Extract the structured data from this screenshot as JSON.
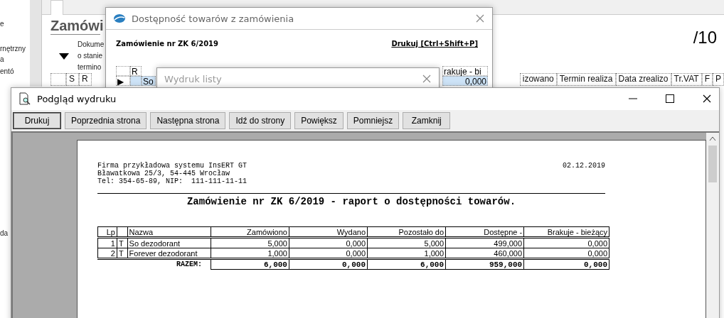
{
  "background_app": {
    "sidebar_items": [
      "e",
      "rnętrzny",
      "a",
      "entó",
      "da"
    ],
    "heading": "Zamówi",
    "info_lines": [
      "Dokume",
      "o stanie",
      "termino"
    ],
    "page_counter": "/10",
    "grid_columns_left": [
      "S",
      "R"
    ],
    "grid_columns_right": [
      "izowano",
      "Termin realiza",
      "Data zrealizo",
      "Tr.VAT",
      "F",
      "P"
    ]
  },
  "availability_dialog": {
    "title": "Dostępność towarów z zamówienia",
    "order_label": "Zamówienie nr ZK 6/2019",
    "print_link": "Drukuj [Ctrl+Shift+P]",
    "grid": {
      "row_pointer": "▶",
      "column_r": "R",
      "column_shortage": "rakuje - bi",
      "row_name": "So",
      "shortage_value": "0,000",
      "row_selected": true
    }
  },
  "print_list_window": {
    "title": "Wydruk listy"
  },
  "preview": {
    "title": "Podgląd wydruku",
    "toolbar": [
      {
        "label": "Drukuj",
        "selected": true
      },
      {
        "label": "Poprzednia strona",
        "selected": false
      },
      {
        "label": "Następna strona",
        "selected": false
      },
      {
        "label": "Idź do strony",
        "selected": false
      },
      {
        "label": "Powiększ",
        "selected": false
      },
      {
        "label": "Pomniejsz",
        "selected": false
      },
      {
        "label": "Zamknij",
        "selected": false
      }
    ],
    "report": {
      "company_lines": [
        "Firma przykładowa systemu InsERT GT",
        "Bławatkowa 25/3, 54-445 Wrocław",
        "Tel: 354-65-89, NIP:  111-111-11-11"
      ],
      "date": "02.12.2019",
      "title": "Zamówienie nr ZK 6/2019 - raport o dostępności towarów.",
      "columns": [
        "Lp",
        "",
        "Nazwa",
        "Zamówiono",
        "Wydano",
        "Pozostało do",
        "Dostępne -",
        "Brakuje - bieżący"
      ],
      "rows": [
        {
          "lp": "1",
          "type": "T",
          "name": "So dezodorant",
          "values": [
            "5,000",
            "0,000",
            "5,000",
            "499,000",
            "0,000"
          ]
        },
        {
          "lp": "2",
          "type": "T",
          "name": "Forever dezodorant",
          "values": [
            "1,000",
            "0,000",
            "1,000",
            "460,000",
            "0,000"
          ]
        }
      ],
      "total_label": "RAZEM:",
      "totals": [
        "6,000",
        "0,000",
        "6,000",
        "959,000",
        "0,000"
      ]
    }
  }
}
